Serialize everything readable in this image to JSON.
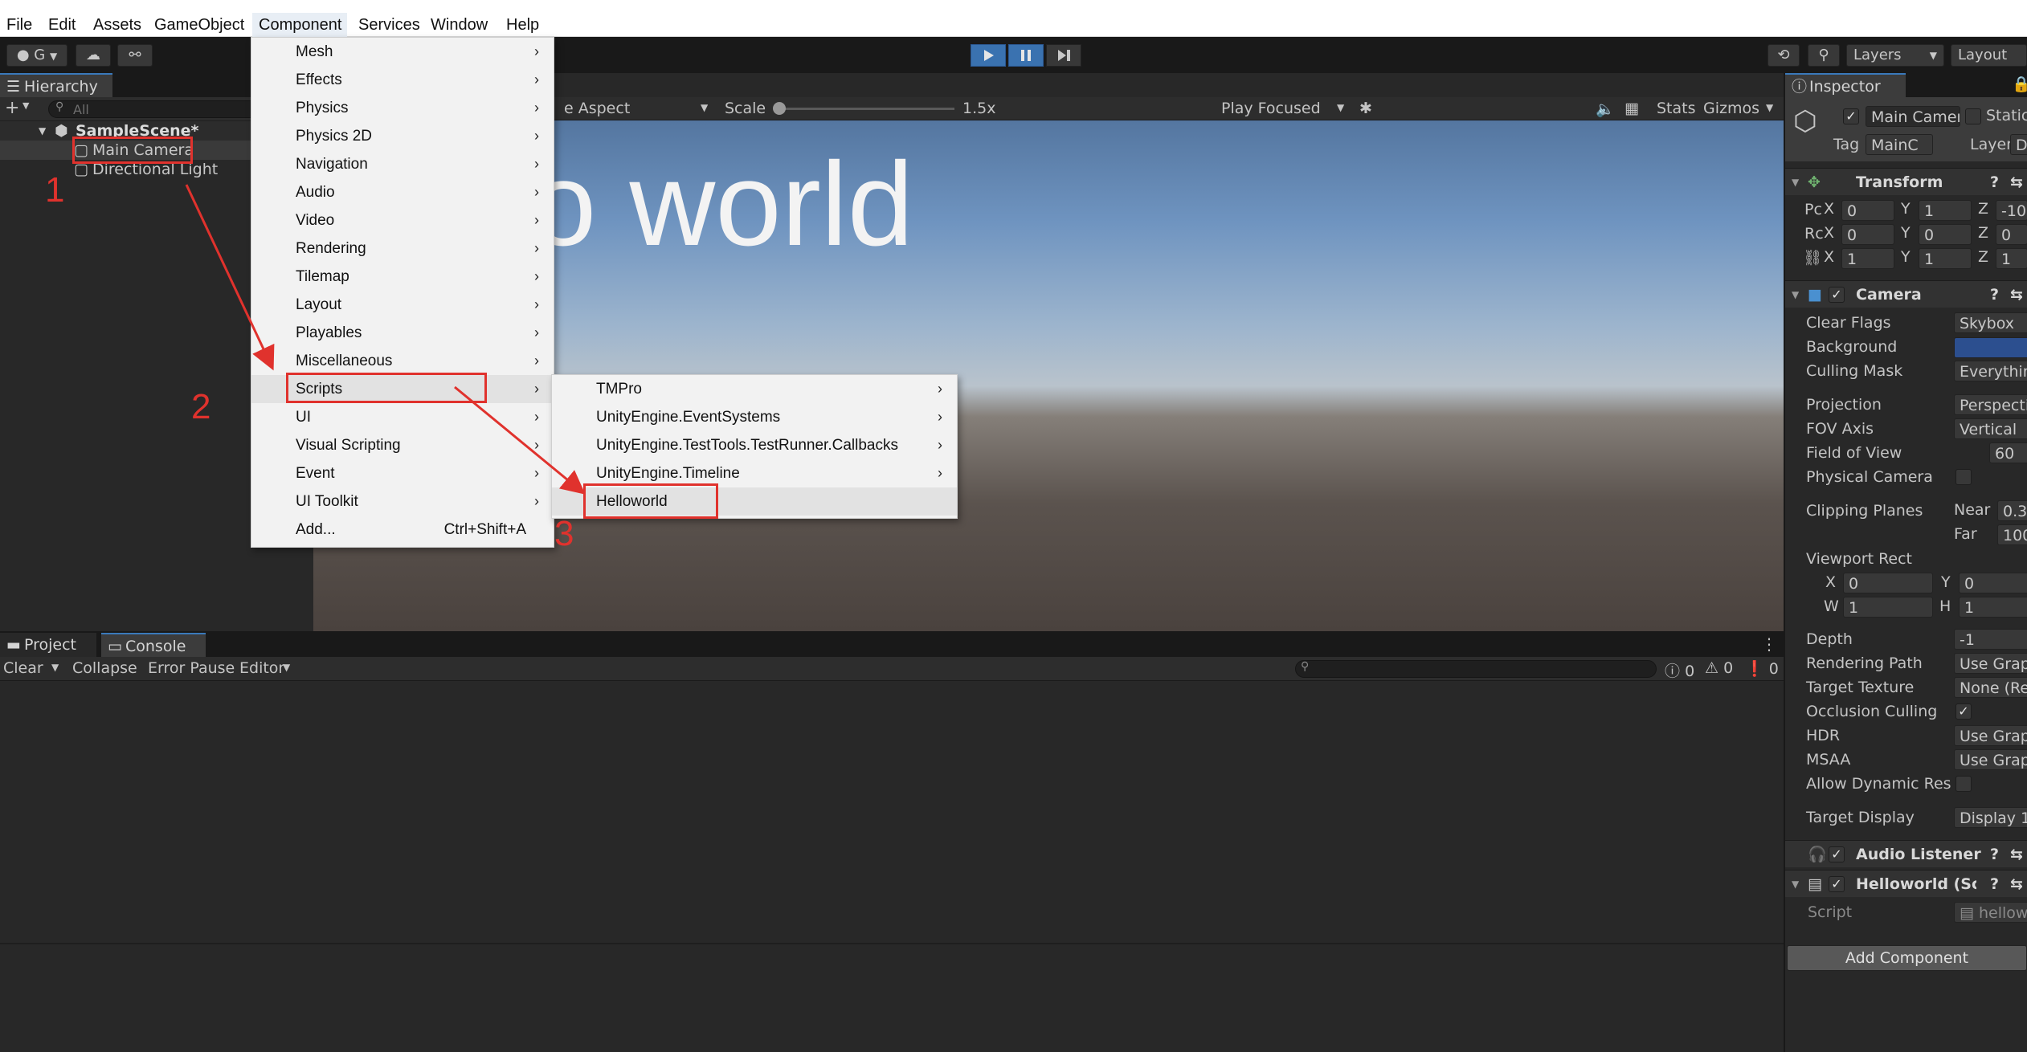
{
  "menubar": {
    "items": [
      "File",
      "Edit",
      "Assets",
      "GameObject",
      "Component",
      "Services",
      "Window",
      "Help"
    ]
  },
  "toolbar": {
    "account_label": "G",
    "layers_label": "Layers",
    "layout_label": "Layout"
  },
  "hierarchy": {
    "tab_label": "Hierarchy",
    "search_placeholder": "All",
    "scene_name": "SampleScene*",
    "items": [
      "Main Camera",
      "Directional Light"
    ]
  },
  "game_view": {
    "aspect_label": "e Aspect",
    "scale_label": "Scale",
    "scale_value": "1.5x",
    "play_mode_label": "Play Focused",
    "stats_label": "Stats",
    "gizmos_label": "Gizmos",
    "scene_text": "o world"
  },
  "component_menu": {
    "items": [
      {
        "label": "Mesh",
        "submenu": true
      },
      {
        "label": "Effects",
        "submenu": true
      },
      {
        "label": "Physics",
        "submenu": true
      },
      {
        "label": "Physics 2D",
        "submenu": true
      },
      {
        "label": "Navigation",
        "submenu": true
      },
      {
        "label": "Audio",
        "submenu": true
      },
      {
        "label": "Video",
        "submenu": true
      },
      {
        "label": "Rendering",
        "submenu": true
      },
      {
        "label": "Tilemap",
        "submenu": true
      },
      {
        "label": "Layout",
        "submenu": true
      },
      {
        "label": "Playables",
        "submenu": true
      },
      {
        "label": "Miscellaneous",
        "submenu": true
      },
      {
        "label": "Scripts",
        "submenu": true
      },
      {
        "label": "UI",
        "submenu": true
      },
      {
        "label": "Visual Scripting",
        "submenu": true
      },
      {
        "label": "Event",
        "submenu": true
      },
      {
        "label": "UI Toolkit",
        "submenu": true
      }
    ],
    "add_label": "Add...",
    "add_shortcut": "Ctrl+Shift+A"
  },
  "scripts_submenu": {
    "items": [
      {
        "label": "TMPro",
        "submenu": true
      },
      {
        "label": "UnityEngine.EventSystems",
        "submenu": true
      },
      {
        "label": "UnityEngine.TestTools.TestRunner.Callbacks",
        "submenu": true
      },
      {
        "label": "UnityEngine.Timeline",
        "submenu": true
      },
      {
        "label": "Helloworld",
        "submenu": false
      }
    ]
  },
  "annotations": {
    "step1": "1",
    "step2": "2",
    "step3": "3",
    "color": "#e0322d"
  },
  "console": {
    "project_tab": "Project",
    "console_tab": "Console",
    "clear_label": "Clear",
    "collapse_label": "Collapse",
    "error_pause_label": "Error Pause",
    "editor_label": "Editor",
    "log_count": "0",
    "warn_count": "0",
    "error_count": "0"
  },
  "inspector": {
    "tab_label": "Inspector",
    "object_name": "Main Camer",
    "static_label": "Static",
    "tag_label": "Tag",
    "tag_value": "MainC",
    "layer_label": "Layer",
    "layer_value": "Defa",
    "transform": {
      "title": "Transform",
      "rows": [
        {
          "label": "Pc",
          "x": "0",
          "y": "1",
          "z": "-10"
        },
        {
          "label": "Rc",
          "x": "0",
          "y": "0",
          "z": "0"
        },
        {
          "label": "",
          "x": "1",
          "y": "1",
          "z": "1"
        }
      ]
    },
    "camera": {
      "title": "Camera",
      "clear_flags_label": "Clear Flags",
      "clear_flags_value": "Skybox",
      "background_label": "Background",
      "background_color": "#2c4f8f",
      "culling_mask_label": "Culling Mask",
      "culling_mask_value": "Everythin",
      "projection_label": "Projection",
      "projection_value": "Perspecti",
      "fov_axis_label": "FOV Axis",
      "fov_axis_value": "Vertical",
      "fov_label": "Field of View",
      "fov_value": "60",
      "physical_camera_label": "Physical Camera",
      "clipping_label": "Clipping Planes",
      "near_label": "Near",
      "near_value": "0.3",
      "far_label": "Far",
      "far_value": "100",
      "viewport_label": "Viewport Rect",
      "vx": "0",
      "vy": "0",
      "vw": "1",
      "vh": "1",
      "depth_label": "Depth",
      "depth_value": "-1",
      "rendering_path_label": "Rendering Path",
      "rendering_path_value": "Use Graph",
      "target_texture_label": "Target Texture",
      "target_texture_value": "None (Rer",
      "occlusion_label": "Occlusion Culling",
      "hdr_label": "HDR",
      "hdr_value": "Use Graph",
      "msaa_label": "MSAA",
      "msaa_value": "Use Graph",
      "dynamic_res_label": "Allow Dynamic Reso",
      "target_display_label": "Target Display",
      "target_display_value": "Display 1"
    },
    "audio_listener_title": "Audio Listener",
    "helloworld_title": "Helloworld (Scri",
    "script_label": "Script",
    "script_value": "hellowo",
    "add_component_label": "Add Component"
  }
}
